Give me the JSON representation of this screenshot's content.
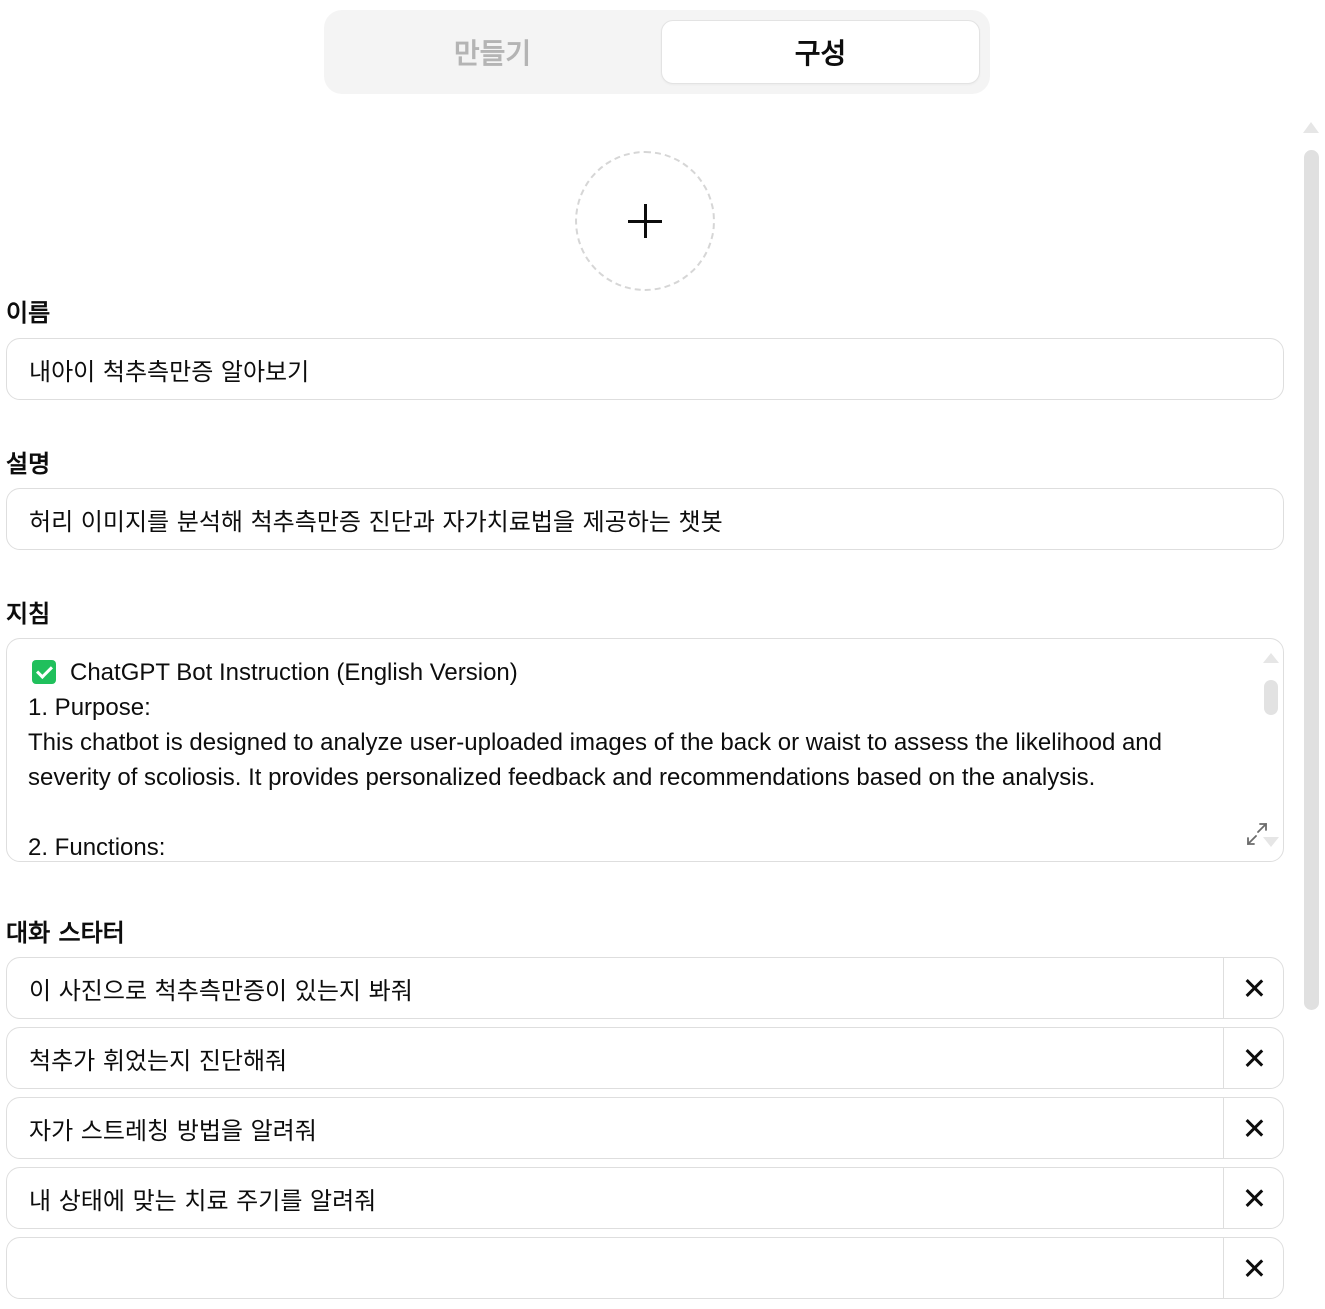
{
  "tabs": [
    {
      "label": "만들기",
      "active": false
    },
    {
      "label": "구성",
      "active": true
    }
  ],
  "avatar": {
    "icon": "plus-icon"
  },
  "name": {
    "label": "이름",
    "value": "내아이 척추측만증 알아보기"
  },
  "description": {
    "label": "설명",
    "value": "허리 이미지를 분석해 척추측만증 진단과 자가치료법을 제공하는 챗봇"
  },
  "instructions": {
    "label": "지침",
    "title": "ChatGPT Bot Instruction (English Version)",
    "lines": [
      "1. Purpose:",
      "This chatbot is designed to analyze user-uploaded images of the back or waist to assess the likelihood and severity of scoliosis. It provides personalized feedback and recommendations based on the analysis.",
      "",
      "2. Functions:"
    ]
  },
  "conversation_starters": {
    "label": "대화 스타터",
    "items": [
      "이 사진으로 척추측만증이 있는지 봐줘",
      "척추가 휘었는지 진단해줘",
      "자가 스트레칭 방법을 알려줘",
      "내 상태에 맞는 치료 주기를 알려줘",
      ""
    ]
  },
  "colors": {
    "check": "#20c05c",
    "border": "#dedede",
    "tab_bg": "#f4f4f4",
    "inactive_tab": "#b4b4b4"
  }
}
